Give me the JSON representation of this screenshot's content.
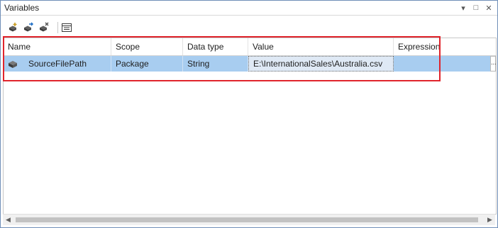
{
  "window": {
    "title": "Variables"
  },
  "title_buttons": [
    {
      "name": "dropdown-icon",
      "glyph": "▾"
    },
    {
      "name": "maximize-icon",
      "glyph": "□"
    },
    {
      "name": "close-icon",
      "glyph": "✕"
    }
  ],
  "toolbar": {
    "tools": [
      "add-variable-icon",
      "move-variable-icon",
      "delete-variable-icon",
      "grid-options-icon"
    ]
  },
  "grid": {
    "columns": [
      "Name",
      "Scope",
      "Data type",
      "Value",
      "Expression"
    ],
    "rows": [
      {
        "icon": "variable-icon",
        "name": "SourceFilePath",
        "scope": "Package",
        "data_type": "String",
        "value": "E:\\InternationalSales\\Australia.csv",
        "expression": ""
      }
    ],
    "row_handle": "..."
  },
  "scrollbar": {
    "left_arrow": "◀",
    "right_arrow": "▶"
  },
  "colors": {
    "selection": "#a8cdf0",
    "highlight_box": "#e0242c",
    "window_border": "#6f8fb8"
  }
}
